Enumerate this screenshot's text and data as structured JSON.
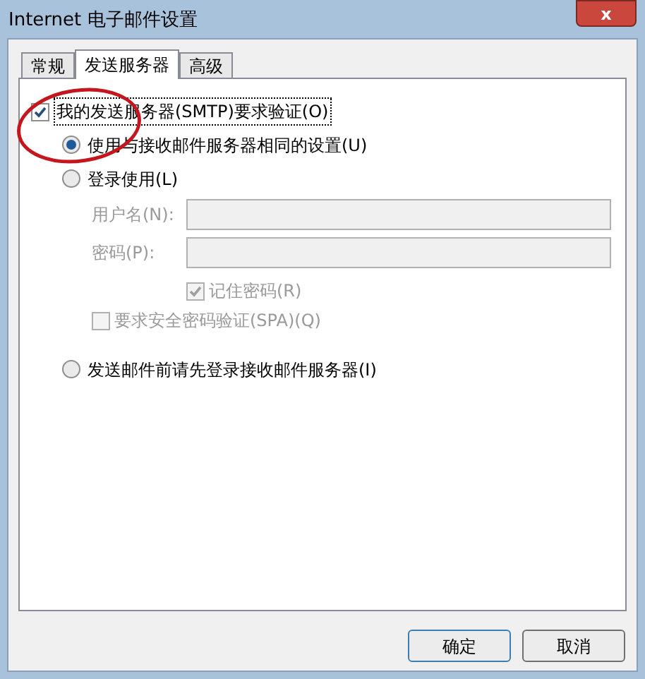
{
  "window": {
    "title": "Internet 电子邮件设置",
    "close": "x"
  },
  "tabs": [
    {
      "label": "常规",
      "selected": false
    },
    {
      "label": "发送服务器",
      "selected": true
    },
    {
      "label": "高级",
      "selected": false
    }
  ],
  "auth": {
    "label": "我的发送服务器(SMTP)要求验证(O)",
    "checked": true
  },
  "options": [
    {
      "kind": "radio",
      "label": "使用与接收邮件服务器相同的设置(U)",
      "selected": true
    },
    {
      "kind": "radio",
      "label": "登录使用(L)",
      "selected": false
    }
  ],
  "login": {
    "disabled": true,
    "fields": [
      {
        "label": "用户名(N):"
      },
      {
        "label": "密码(P):"
      }
    ],
    "remember": {
      "label": "记住密码(R)",
      "checked": true
    },
    "spa": {
      "label": "要求安全密码验证(SPA)(Q)",
      "checked": false
    }
  },
  "last_option": {
    "label": "发送邮件前请先登录接收邮件服务器(I)",
    "selected": false
  },
  "buttons": [
    "确定",
    "取消"
  ]
}
